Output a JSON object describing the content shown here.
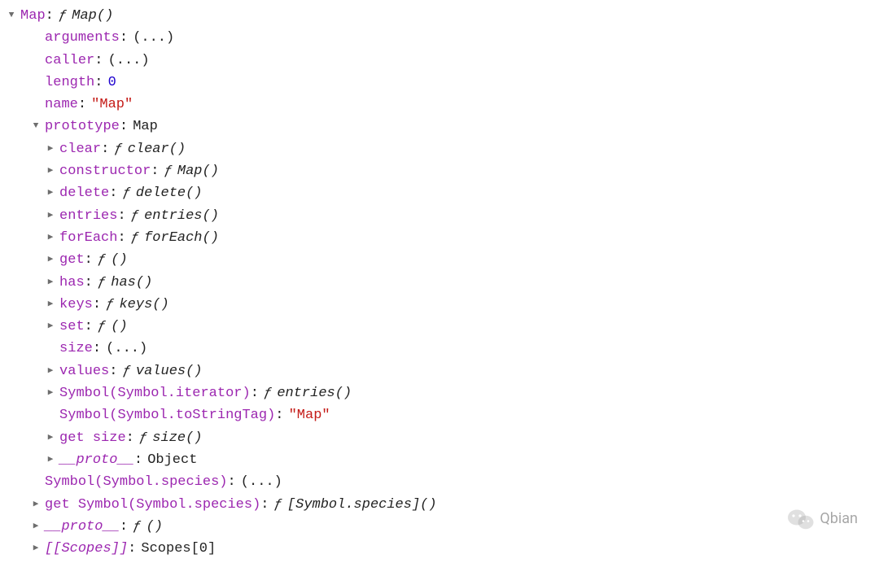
{
  "tree": [
    {
      "indent": 0,
      "arrow": "down",
      "key": "Map",
      "keyClass": "key-purple",
      "value": {
        "type": "fn",
        "name": "Map()"
      }
    },
    {
      "indent": 1,
      "arrow": "none",
      "key": "arguments",
      "keyClass": "key-purple",
      "value": {
        "type": "ellipsis"
      }
    },
    {
      "indent": 1,
      "arrow": "none",
      "key": "caller",
      "keyClass": "key-purple",
      "value": {
        "type": "ellipsis"
      }
    },
    {
      "indent": 1,
      "arrow": "none",
      "key": "length",
      "keyClass": "key-purple",
      "value": {
        "type": "num",
        "text": "0"
      }
    },
    {
      "indent": 1,
      "arrow": "none",
      "key": "name",
      "keyClass": "key-purple",
      "value": {
        "type": "str",
        "text": "\"Map\""
      }
    },
    {
      "indent": 1,
      "arrow": "down",
      "key": "prototype",
      "keyClass": "key-purple",
      "value": {
        "type": "obj",
        "text": "Map"
      }
    },
    {
      "indent": 2,
      "arrow": "right",
      "key": "clear",
      "keyClass": "key-purple",
      "value": {
        "type": "fn",
        "name": "clear()"
      }
    },
    {
      "indent": 2,
      "arrow": "right",
      "key": "constructor",
      "keyClass": "key-purple",
      "value": {
        "type": "fn",
        "name": "Map()"
      }
    },
    {
      "indent": 2,
      "arrow": "right",
      "key": "delete",
      "keyClass": "key-purple",
      "value": {
        "type": "fn",
        "name": "delete()"
      }
    },
    {
      "indent": 2,
      "arrow": "right",
      "key": "entries",
      "keyClass": "key-purple",
      "value": {
        "type": "fn",
        "name": "entries()"
      }
    },
    {
      "indent": 2,
      "arrow": "right",
      "key": "forEach",
      "keyClass": "key-purple",
      "value": {
        "type": "fn",
        "name": "forEach()"
      }
    },
    {
      "indent": 2,
      "arrow": "right",
      "key": "get",
      "keyClass": "key-purple",
      "value": {
        "type": "fn",
        "name": "()"
      }
    },
    {
      "indent": 2,
      "arrow": "right",
      "key": "has",
      "keyClass": "key-purple",
      "value": {
        "type": "fn",
        "name": "has()"
      }
    },
    {
      "indent": 2,
      "arrow": "right",
      "key": "keys",
      "keyClass": "key-purple",
      "value": {
        "type": "fn",
        "name": "keys()"
      }
    },
    {
      "indent": 2,
      "arrow": "right",
      "key": "set",
      "keyClass": "key-purple",
      "value": {
        "type": "fn",
        "name": "()"
      }
    },
    {
      "indent": 2,
      "arrow": "none",
      "key": "size",
      "keyClass": "key-purple",
      "value": {
        "type": "ellipsis"
      }
    },
    {
      "indent": 2,
      "arrow": "right",
      "key": "values",
      "keyClass": "key-purple",
      "value": {
        "type": "fn",
        "name": "values()"
      }
    },
    {
      "indent": 2,
      "arrow": "right",
      "key": "Symbol(Symbol.iterator)",
      "keyClass": "key-purple",
      "value": {
        "type": "fn",
        "name": "entries()"
      }
    },
    {
      "indent": 2,
      "arrow": "none",
      "key": "Symbol(Symbol.toStringTag)",
      "keyClass": "key-purple",
      "value": {
        "type": "str",
        "text": "\"Map\""
      }
    },
    {
      "indent": 2,
      "arrow": "right",
      "key": "get size",
      "keyClass": "key-purple",
      "value": {
        "type": "fn",
        "name": "size()"
      }
    },
    {
      "indent": 2,
      "arrow": "right",
      "key": "__proto__",
      "keyClass": "key-internal",
      "value": {
        "type": "obj",
        "text": "Object"
      }
    },
    {
      "indent": 1,
      "arrow": "none",
      "key": "Symbol(Symbol.species)",
      "keyClass": "key-purple",
      "value": {
        "type": "ellipsis"
      }
    },
    {
      "indent": 1,
      "arrow": "right",
      "key": "get Symbol(Symbol.species)",
      "keyClass": "key-purple",
      "value": {
        "type": "fn",
        "name": "[Symbol.species]()"
      }
    },
    {
      "indent": 1,
      "arrow": "right",
      "key": "__proto__",
      "keyClass": "key-internal",
      "value": {
        "type": "fn",
        "name": "()"
      }
    },
    {
      "indent": 1,
      "arrow": "right",
      "key": "[[Scopes]]",
      "keyClass": "key-internal",
      "value": {
        "type": "obj",
        "text": "Scopes[0]"
      }
    }
  ],
  "glyphs": {
    "down": "▼",
    "right": "▶",
    "ellipsis": "(...)",
    "f": "ƒ"
  },
  "watermark": "Qbian"
}
